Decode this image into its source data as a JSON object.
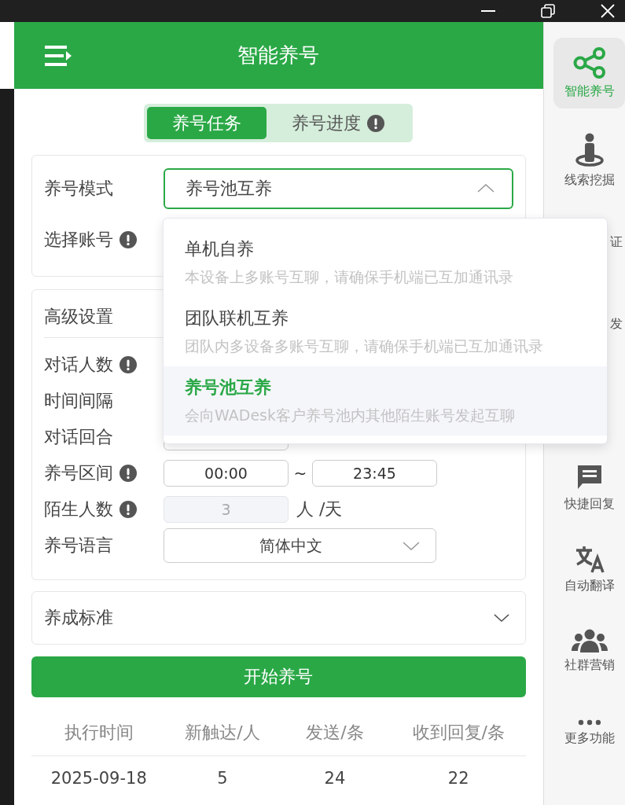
{
  "header": {
    "title": "智能养号"
  },
  "tabs": [
    {
      "label": "养号任务",
      "selected": true,
      "info": false
    },
    {
      "label": "养号进度",
      "selected": false,
      "info": true
    }
  ],
  "mode_card": {
    "rows": [
      {
        "label": "养号模式",
        "info": false,
        "kind": "select",
        "value": "养号池互养",
        "open": true
      },
      {
        "label": "选择账号",
        "info": true,
        "kind": "hidden"
      }
    ]
  },
  "advanced_card": {
    "title": "高级设置",
    "rows": [
      {
        "label": "对话人数",
        "info": true,
        "kind": "hidden"
      },
      {
        "label": "时间间隔",
        "info": false,
        "kind": "hidden"
      },
      {
        "label": "对话回合",
        "info": false,
        "kind": "covered"
      },
      {
        "label": "养号区间",
        "info": true,
        "kind": "range",
        "from": "00:00",
        "separator": "~",
        "to": "23:45"
      },
      {
        "label": "陌生人数",
        "info": true,
        "kind": "number",
        "value": "3",
        "disabled": true,
        "unit": "人 /天"
      },
      {
        "label": "养号语言",
        "info": false,
        "kind": "select",
        "value": "简体中文",
        "open": false
      }
    ]
  },
  "standard_card": {
    "title": "养成标准",
    "expanded": false
  },
  "start_button": {
    "label": "开始养号"
  },
  "table": {
    "columns": [
      "执行时间",
      "新触达/人",
      "发送/条",
      "收到回复/条"
    ],
    "rows": [
      [
        "2025-09-18",
        "5",
        "24",
        "22"
      ]
    ]
  },
  "dropdown": {
    "options": [
      {
        "title": "单机自养",
        "description": "本设备上多账号互聊，请确保手机端已互加通讯录",
        "selected": false
      },
      {
        "title": "团队联机互养",
        "description": "团队内多设备多账号互聊，请确保手机端已互加通讯录",
        "selected": false
      },
      {
        "title": "养号池互养",
        "description": "会向WADesk客户养号池内其他陌生账号发起互聊",
        "selected": true
      }
    ]
  },
  "sidebar": {
    "items": [
      {
        "label": "智能养号",
        "kind": "share",
        "selected": true
      },
      {
        "label": "线索挖掘",
        "kind": "person",
        "selected": false
      },
      {
        "label": "证",
        "kind": "covered",
        "selected": false
      },
      {
        "label": "发",
        "kind": "covered",
        "selected": false
      },
      {
        "kind": "covered",
        "selected": false
      },
      {
        "label": "快捷回复",
        "kind": "chat",
        "selected": false
      },
      {
        "label": "自动翻译",
        "kind": "translate",
        "selected": false
      },
      {
        "label": "社群营销",
        "kind": "group",
        "selected": false
      },
      {
        "label": "更多功能",
        "kind": "more",
        "selected": false
      }
    ]
  }
}
